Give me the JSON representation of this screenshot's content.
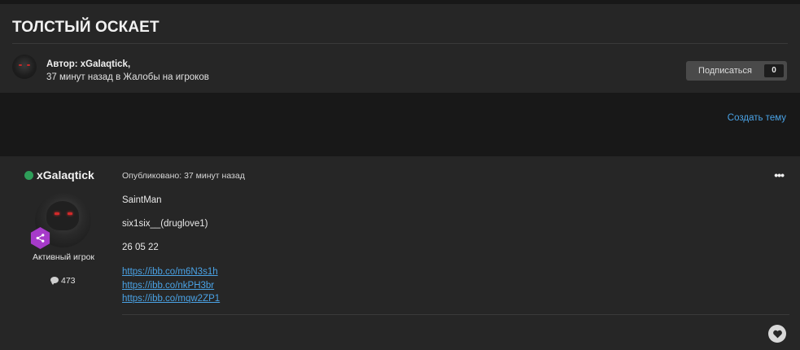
{
  "topic": {
    "title": "ТОЛСТЫЙ ОСКАЕТ",
    "author_line": "Автор: xGalaqtick,",
    "meta_line": "37 минут назад в Жалобы на игроков",
    "follow_label": "Подписаться",
    "follow_count": "0"
  },
  "actions": {
    "create_topic": "Создать тему"
  },
  "post": {
    "author": "xGalaqtick",
    "rank": "Активный игрок",
    "post_count": "473",
    "published": "Опубликовано: 37 минут назад",
    "menu": "•••",
    "lines": [
      "SaintMan",
      "six1six__(druglove1)",
      "26 05 22"
    ],
    "links": [
      "https://ibb.co/m6N3s1h",
      "https://ibb.co/nkPH3br",
      "https://ibb.co/mqw2ZP1"
    ]
  },
  "icons": {
    "online": "online-status-dot",
    "rank": "share-network-icon",
    "posts": "comment-bubble-icon",
    "react": "heart-icon"
  },
  "colors": {
    "accent_link": "#4aa3e6",
    "online": "#2e9e59",
    "rank_badge": "#a63ac9"
  }
}
